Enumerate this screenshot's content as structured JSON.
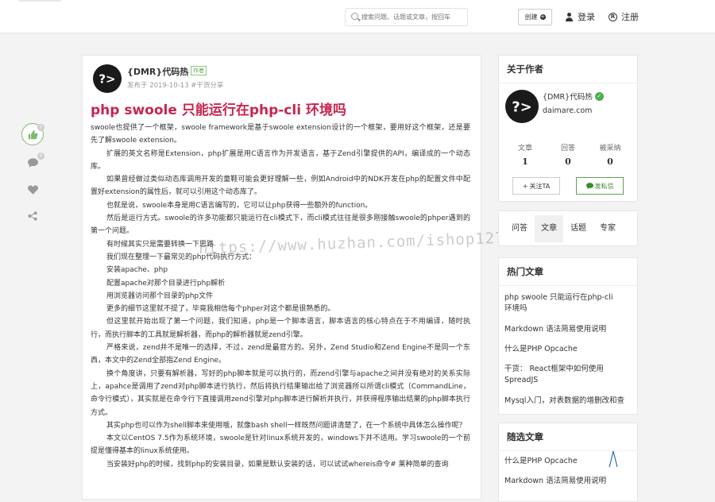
{
  "header": {
    "search_placeholder": "搜索问题、话题或文章，按回车",
    "create_label": "创建",
    "login_label": "登录",
    "register_label": "注册"
  },
  "share_bar": {
    "like_count": "0",
    "comment_count": "0"
  },
  "article": {
    "author_name": "{DMR}代码热",
    "author_tag": "作者",
    "publish_meta": "发布于 2019-10-13 #干货分享",
    "title": "php swoole 只能运行在php-cli 环境吗",
    "paragraphs": [
      {
        "text": "swoole也提供了一个框架，swoole framework是基于swoole extension设计的一个框架，要用好这个框架，还是要先了解swoole extension。",
        "indent": false
      },
      {
        "text": "扩展的英文名称是Extension，php扩展是用C语言作为开发语言，基于Zend引擎提供的API，编译成的一个动态库。",
        "indent": true
      },
      {
        "text": "如果曾经做过类似动态库调用开发的童鞋可能会更好理解一些，例如Android中的NDK开发在php的配置文件中配置好extension的属性后，就可以引用这个动态库了。",
        "indent": true
      },
      {
        "text": "也就是说，swoole本身是用C语言编写的，它可以让php获得一些额外的function。",
        "indent": true
      },
      {
        "text": "然后是运行方式。swoole的许多功能都只能运行在cli模式下，而cli模式往往是很多刚接触swoole的phper遇到的第一个问题。",
        "indent": true
      },
      {
        "text": "有时候其实只是需要转换一下思路",
        "indent": true
      },
      {
        "text": "我们现在整理一下最常见的php代码执行方式：",
        "indent": true
      },
      {
        "text": "安装apache、php",
        "indent": true
      },
      {
        "text": "配置apache对那个目录进行php解析",
        "indent": true
      },
      {
        "text": "用浏览器访问那个目录的php文件",
        "indent": true
      },
      {
        "text": "更多的细节这里就不提了，毕竟我相信每个phper对这个都是很熟悉的。",
        "indent": true
      },
      {
        "text": "但这里就开始出现了第一个问题，我们知道，php是一个脚本语言，脚本语言的核心特点在于不用编译，随时执行，而执行脚本的工具就是解析器，而php的解析器就是zend引擎。",
        "indent": true
      },
      {
        "text": "严格来说，zend并不是唯一的选择，不过，zend是最官方的。另外，Zend Studio和Zend Engine不是同一个东西，本文中的Zend全部指Zend Engine。",
        "indent": true
      },
      {
        "text": "换个角度讲，只要有解析器，写好的php脚本就是可以执行的，而zend引擎与apache之间并没有绝对的关系实际上，apahce是调用了zend对php脚本进行执行，然后将执行结果输出给了浏览器所以所谓cli模式（CommandLine，命令行模式），其实就是在命令行下直接调用zend引擎对php脚本进行解析并执行，并获得程序输出结果的php脚本执行方式。",
        "indent": true
      },
      {
        "text": "其实php也可以作为shell脚本来使用哦，就像bash shell一样既然问题讲清楚了，在一个系统中具体怎么操作呢？",
        "indent": true
      },
      {
        "text": "本文以CentOS 7.5作为系统环境，swoole是针对linux系统开发的，windows下并不适用。学习swoole的一个前提是懂得基本的linux系统使用。",
        "indent": true
      },
      {
        "text": "当安装好php的时候，找到php的安装目录，如果是默认安装的话，可以试试whereis命令# 莱种简单的查询",
        "indent": true
      }
    ],
    "watermark": "https://www.huzhan.com/ishop12715"
  },
  "sidebar": {
    "about": {
      "title": "关于作者",
      "name": "{DMR}代码热",
      "site": "daimare.com",
      "stats": [
        {
          "label": "文章",
          "value": "1"
        },
        {
          "label": "回答",
          "value": "0"
        },
        {
          "label": "被采纳",
          "value": "0"
        }
      ],
      "follow_label": "关注TA",
      "message_label": "发私信"
    },
    "tabs": [
      "问答",
      "文章",
      "话题",
      "专家"
    ],
    "active_tab": "文章",
    "hot": {
      "title": "热门文章",
      "items": [
        "php swoole 只能运行在php-cli 环境吗",
        "Markdown 语法简易使用说明",
        "什么是PHP Opcache",
        "干货： React框架中如何使用SpreadJS",
        "Mysql入门，对表数据的增删改和查"
      ]
    },
    "picks": {
      "title": "随选文章",
      "items": [
        "什么是PHP Opcache",
        "Markdown 语法简易使用说明"
      ]
    }
  },
  "colors": {
    "title": "#c7254e",
    "accent_green": "#5fa44e"
  }
}
